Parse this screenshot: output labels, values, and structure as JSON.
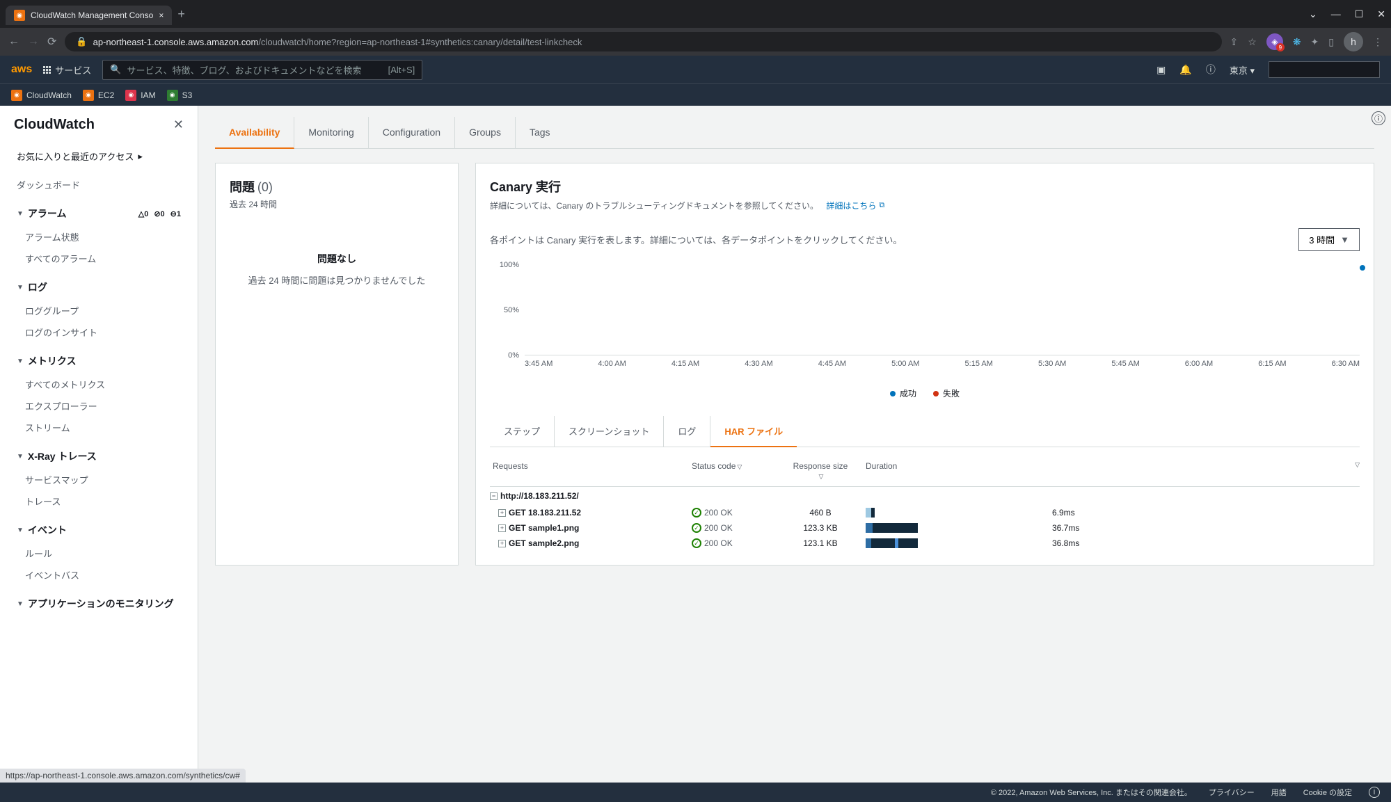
{
  "browser": {
    "tab_title": "CloudWatch Management Conso",
    "url_domain": "ap-northeast-1.console.aws.amazon.com",
    "url_path": "/cloudwatch/home?region=ap-northeast-1#synthetics:canary/detail/test-linkcheck",
    "ext_badge": "9",
    "avatar": "h",
    "status_url": "https://ap-northeast-1.console.aws.amazon.com/synthetics/cw#"
  },
  "aws_header": {
    "services": "サービス",
    "search_placeholder": "サービス、特徴、ブログ、およびドキュメントなどを検索",
    "search_shortcut": "[Alt+S]",
    "region": "東京"
  },
  "favorites": [
    {
      "name": "CloudWatch",
      "cls": "fav-cw"
    },
    {
      "name": "EC2",
      "cls": "fav-ec2"
    },
    {
      "name": "IAM",
      "cls": "fav-iam"
    },
    {
      "name": "S3",
      "cls": "fav-s3"
    }
  ],
  "sidebar": {
    "title": "CloudWatch",
    "fav_link": "お気に入りと最近のアクセス",
    "dashboard": "ダッシュボード",
    "sections": {
      "alarm": {
        "title": "アラーム",
        "badges": {
          "a": "0",
          "b": "0",
          "c": "1"
        },
        "items": [
          "アラーム状態",
          "すべてのアラーム"
        ]
      },
      "log": {
        "title": "ログ",
        "items": [
          "ロググループ",
          "ログのインサイト"
        ]
      },
      "metrics": {
        "title": "メトリクス",
        "items": [
          "すべてのメトリクス",
          "エクスプローラー",
          "ストリーム"
        ]
      },
      "xray": {
        "title": "X-Ray トレース",
        "items": [
          "サービスマップ",
          "トレース"
        ]
      },
      "events": {
        "title": "イベント",
        "items": [
          "ルール",
          "イベントバス"
        ]
      },
      "appmon": {
        "title": "アプリケーションのモニタリング"
      }
    }
  },
  "tabs": [
    "Availability",
    "Monitoring",
    "Configuration",
    "Groups",
    "Tags"
  ],
  "issues_panel": {
    "title": "問題",
    "count": "(0)",
    "subtitle": "過去 24 時間",
    "no_issues_title": "問題なし",
    "no_issues_text": "過去 24 時間に問題は見つかりませんでした"
  },
  "canary_panel": {
    "title": "Canary 実行",
    "description": "詳細については、Canary のトラブルシューティングドキュメントを参照してください。",
    "details_link": "詳細はこちら",
    "chart_hint": "各ポイントは Canary 実行を表します。詳細については、各データポイントをクリックしてください。",
    "time_range": "3 時間"
  },
  "chart_data": {
    "type": "scatter",
    "ylabel": "",
    "ylim": [
      0,
      100
    ],
    "y_ticks": [
      "100%",
      "50%",
      "0%"
    ],
    "x_ticks": [
      "3:45 AM",
      "4:00 AM",
      "4:15 AM",
      "4:30 AM",
      "4:45 AM",
      "5:00 AM",
      "5:15 AM",
      "5:30 AM",
      "5:45 AM",
      "6:00 AM",
      "6:15 AM",
      "6:30 AM"
    ],
    "series": [
      {
        "name": "成功",
        "color": "#0073bb",
        "points": [
          {
            "x": "6:30 AM",
            "y": 100
          }
        ]
      },
      {
        "name": "失敗",
        "color": "#d13212",
        "points": []
      }
    ]
  },
  "sub_tabs": [
    "ステップ",
    "スクリーンショット",
    "ログ",
    "HAR ファイル"
  ],
  "har": {
    "headers": {
      "requests": "Requests",
      "status": "Status code",
      "size": "Response size",
      "duration": "Duration"
    },
    "group": "http://18.183.211.52/",
    "rows": [
      {
        "req": "GET 18.183.211.52",
        "status": "200 OK",
        "size": "460 B",
        "duration": "6.9ms",
        "bar": [
          {
            "w": 3,
            "c": "#9ec9e2"
          },
          {
            "w": 2,
            "c": "#12293b"
          }
        ]
      },
      {
        "req": "GET sample1.png",
        "status": "200 OK",
        "size": "123.3 KB",
        "duration": "36.7ms",
        "bar": [
          {
            "w": 4,
            "c": "#2e6da4"
          },
          {
            "w": 25,
            "c": "#12293b"
          }
        ]
      },
      {
        "req": "GET sample2.png",
        "status": "200 OK",
        "size": "123.1 KB",
        "duration": "36.8ms",
        "bar": [
          {
            "w": 3,
            "c": "#2e6da4"
          },
          {
            "w": 13,
            "c": "#12293b"
          },
          {
            "w": 2,
            "c": "#4a90d9"
          },
          {
            "w": 11,
            "c": "#12293b"
          }
        ]
      }
    ]
  },
  "footer": {
    "copyright": "© 2022, Amazon Web Services, Inc. またはその関連会社。",
    "links": [
      "プライバシー",
      "用語",
      "Cookie の設定"
    ]
  }
}
